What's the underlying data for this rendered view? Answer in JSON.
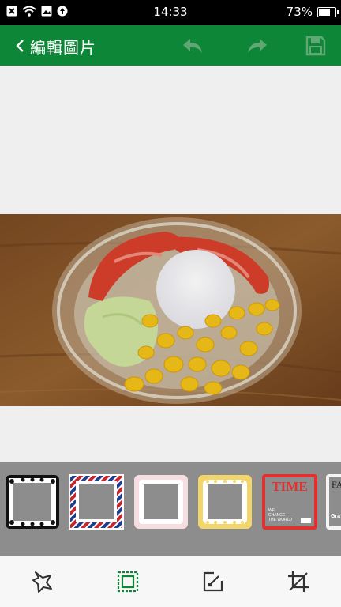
{
  "status_bar": {
    "time": "14:33",
    "battery": "73%",
    "battery_level": 0.73,
    "icons": [
      "close-box-icon",
      "wifi-icon",
      "image-icon",
      "upload-icon"
    ]
  },
  "app_bar": {
    "title": "編輯圖片",
    "color": "#0e8638",
    "actions": [
      "undo-icon",
      "redo-icon",
      "save-icon"
    ]
  },
  "photo": {
    "subject": "salad-bowl-photo"
  },
  "frames": {
    "items": [
      {
        "name": "scalloped-black-frame"
      },
      {
        "name": "airmail-frame"
      },
      {
        "name": "pink-frame"
      },
      {
        "name": "yellow-lace-frame"
      },
      {
        "name": "time-magazine-frame",
        "masthead": "TIME",
        "cover_line_1": "WE",
        "cover_line_2": "CHANGE",
        "cover_line_3": "THE WORLD"
      },
      {
        "name": "fashion-frame",
        "masthead": "FA",
        "cover_line_1": "Gra"
      }
    ]
  },
  "toolbar": {
    "tools": [
      "sticker-icon",
      "frame-icon",
      "draw-icon",
      "crop-icon"
    ],
    "active_color": "#0e8638"
  }
}
